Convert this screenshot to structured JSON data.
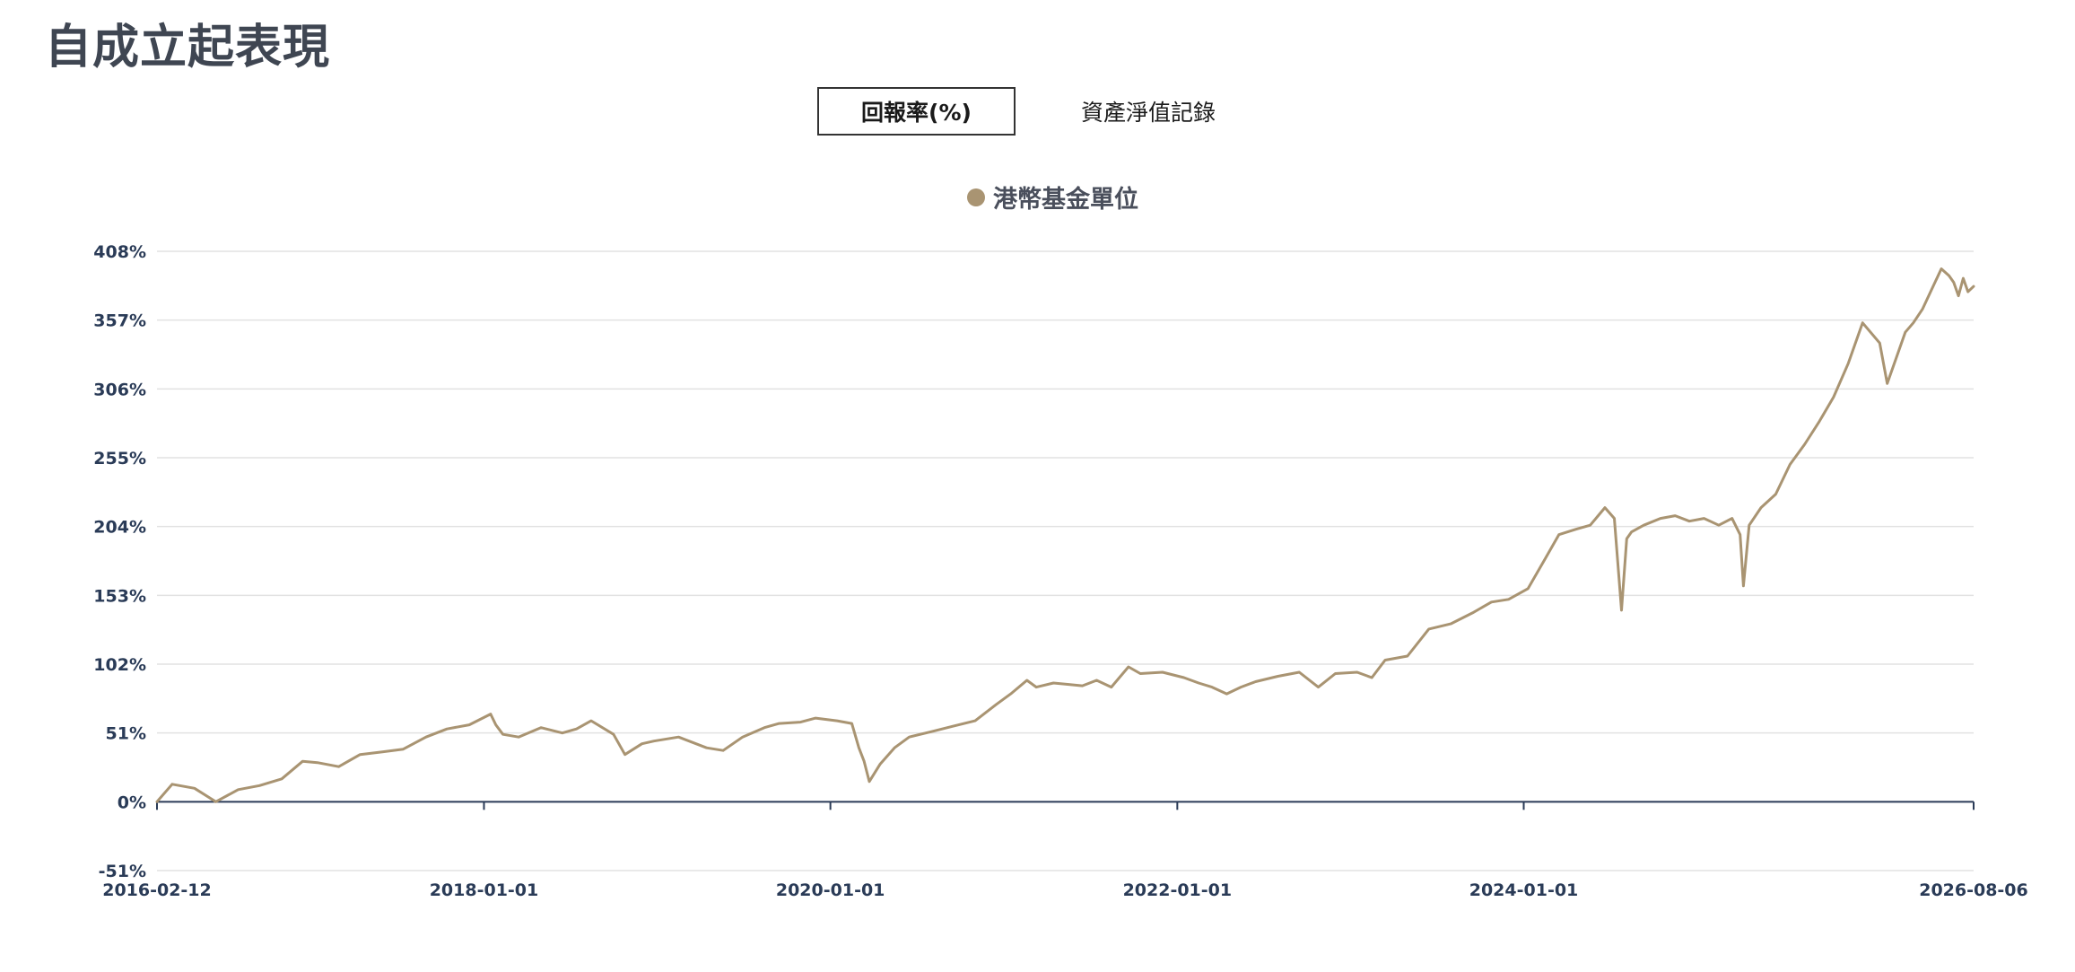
{
  "page": {
    "title": "自成立起表現"
  },
  "tabs": {
    "active_label": "回報率(%)",
    "inactive_label": "資產淨值記錄"
  },
  "legend": {
    "label": "港幣基金單位"
  },
  "colors": {
    "series": "#a99472",
    "grid": "#e2e2e2",
    "axis": "#2a3b57",
    "tick_label": "#2a3b57"
  },
  "chart_data": {
    "type": "line",
    "title": "",
    "xlabel": "",
    "ylabel": "",
    "legend_position": "top-center",
    "grid": true,
    "ylim": [
      -51,
      408
    ],
    "y_ticks": [
      408,
      357,
      306,
      255,
      204,
      153,
      102,
      51,
      0,
      -51
    ],
    "y_tick_labels": [
      "408%",
      "357%",
      "306%",
      "255%",
      "204%",
      "153%",
      "102%",
      "51%",
      "0%",
      "-51%"
    ],
    "xlim": [
      "2016-02-12",
      "2026-08-06"
    ],
    "x_ticks": [
      "2016-02-12",
      "2018-01-01",
      "2020-01-01",
      "2022-01-01",
      "2024-01-01",
      "2026-08-06"
    ],
    "series": [
      {
        "name": "港幣基金單位",
        "x": [
          "2016-02-12",
          "2016-03-15",
          "2016-05-01",
          "2016-06-15",
          "2016-08-01",
          "2016-09-15",
          "2016-11-01",
          "2016-12-15",
          "2017-01-15",
          "2017-03-01",
          "2017-04-15",
          "2017-06-01",
          "2017-07-15",
          "2017-09-01",
          "2017-10-15",
          "2017-12-01",
          "2018-01-15",
          "2018-01-26",
          "2018-02-10",
          "2018-03-15",
          "2018-05-01",
          "2018-06-15",
          "2018-07-15",
          "2018-08-15",
          "2018-10-01",
          "2018-10-25",
          "2018-11-30",
          "2018-12-25",
          "2019-02-15",
          "2019-04-15",
          "2019-05-20",
          "2019-06-30",
          "2019-08-15",
          "2019-09-15",
          "2019-10-30",
          "2019-12-01",
          "2020-01-15",
          "2020-02-15",
          "2020-03-01",
          "2020-03-12",
          "2020-03-23",
          "2020-04-15",
          "2020-05-15",
          "2020-06-15",
          "2020-08-01",
          "2020-09-15",
          "2020-11-01",
          "2020-12-15",
          "2021-01-15",
          "2021-02-18",
          "2021-03-10",
          "2021-04-15",
          "2021-05-15",
          "2021-06-15",
          "2021-07-15",
          "2021-08-15",
          "2021-09-20",
          "2021-10-15",
          "2021-12-01",
          "2022-01-15",
          "2022-02-15",
          "2022-03-15",
          "2022-04-15",
          "2022-05-15",
          "2022-06-15",
          "2022-08-01",
          "2022-09-15",
          "2022-10-25",
          "2022-11-30",
          "2023-01-15",
          "2023-02-15",
          "2023-03-15",
          "2023-05-01",
          "2023-06-15",
          "2023-08-01",
          "2023-09-15",
          "2023-10-25",
          "2023-11-30",
          "2024-01-10",
          "2024-02-15",
          "2024-03-15",
          "2024-04-20",
          "2024-05-20",
          "2024-06-20",
          "2024-07-10",
          "2024-07-25",
          "2024-08-05",
          "2024-08-15",
          "2024-09-10",
          "2024-10-15",
          "2024-11-15",
          "2024-12-15",
          "2025-01-15",
          "2025-02-15",
          "2025-03-15",
          "2025-04-01",
          "2025-04-08",
          "2025-04-20",
          "2025-05-15",
          "2025-06-15",
          "2025-07-15",
          "2025-08-15",
          "2025-09-15",
          "2025-10-15",
          "2025-11-15",
          "2025-12-15",
          "2026-01-20",
          "2026-02-05",
          "2026-02-25",
          "2026-03-15",
          "2026-04-01",
          "2026-04-20",
          "2026-05-10",
          "2026-05-30",
          "2026-06-15",
          "2026-06-25",
          "2026-07-05",
          "2026-07-15",
          "2026-07-25",
          "2026-08-06"
        ],
        "values": [
          0,
          13,
          10,
          0,
          9,
          12,
          17,
          30,
          29,
          26,
          35,
          37,
          39,
          48,
          54,
          57,
          65,
          57,
          50,
          48,
          55,
          51,
          54,
          60,
          50,
          35,
          43,
          45,
          48,
          40,
          38,
          48,
          55,
          58,
          59,
          62,
          60,
          58,
          40,
          30,
          15,
          28,
          40,
          48,
          52,
          56,
          60,
          72,
          80,
          90,
          85,
          88,
          87,
          86,
          90,
          85,
          100,
          95,
          96,
          92,
          88,
          85,
          80,
          85,
          89,
          93,
          96,
          85,
          95,
          96,
          92,
          105,
          108,
          128,
          132,
          140,
          148,
          150,
          158,
          180,
          198,
          202,
          205,
          218,
          210,
          142,
          195,
          200,
          205,
          210,
          212,
          208,
          210,
          205,
          210,
          198,
          160,
          205,
          218,
          228,
          250,
          265,
          282,
          300,
          325,
          355,
          340,
          310,
          330,
          348,
          355,
          365,
          380,
          395,
          390,
          385,
          375,
          388,
          378,
          382
        ]
      }
    ]
  }
}
